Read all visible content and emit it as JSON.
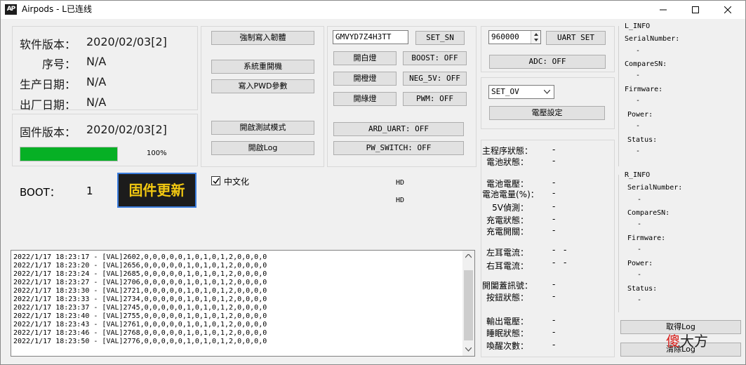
{
  "window": {
    "icon_text": "AP",
    "title": "Airpods - L已连线"
  },
  "info": {
    "software_version_label": "软件版本：",
    "software_version": "2020/02/03[2]",
    "serial_label": "序号：",
    "serial": "N/A",
    "production_date_label": "生产日期：",
    "production_date": "N/A",
    "ship_date_label": "出厂日期：",
    "ship_date": "N/A",
    "firmware_version_label": "固件版本：",
    "firmware_version": "2020/02/03[2]",
    "progress_percent": 100,
    "progress_text": "100%",
    "boot_label": "BOOT：",
    "boot_value": "1",
    "firmware_update_label": "固件更新"
  },
  "actions": {
    "force_write_firmware": "強制寫入韌體",
    "system_reboot": "系統重開機",
    "write_pwd_params": "寫入PWD參數",
    "enable_test_mode": "開啟測試模式",
    "enable_log": "開啟Log",
    "chinese_label": "中文化",
    "chinese_checked": true
  },
  "controls": {
    "sn_input": "GMVYD7Z4H3TT",
    "set_sn": "SET_SN",
    "white_light": "開白燈",
    "orange_light": "開橙燈",
    "green_light": "開綠燈",
    "boost": "BOOST: OFF",
    "neg_5v": "NEG_5V: OFF",
    "pwm": "PWM: OFF",
    "ard_uart": "ARD_UART: OFF",
    "pw_switch": "PW_SWITCH: OFF",
    "hd_1": "HD",
    "hd_2": "HD"
  },
  "uart": {
    "baud": "960000",
    "uart_set": "UART SET",
    "adc": "ADC: OFF",
    "voltage_select": "SET_OV",
    "voltage_set": "電壓設定"
  },
  "status": {
    "main_state_label": "主程序狀態：",
    "main_state": "-",
    "battery_state_label": "電池狀態：",
    "battery_state": "-",
    "battery_voltage_label": "電池電壓：",
    "battery_voltage": "-",
    "battery_level_label": "電池電量(%)：",
    "battery_level": "-",
    "v5_detect_label": "5V偵測：",
    "v5_detect": "-",
    "charge_state_label": "充電狀態：",
    "charge_state": "-",
    "charge_switch_label": "充電開關：",
    "charge_switch": "-",
    "left_current_label": "左耳電流：",
    "left_current_a": "-",
    "left_current_b": "-",
    "right_current_label": "右耳電流：",
    "right_current_a": "-",
    "right_current_b": "-",
    "lid_signal_label": "開闔蓋訊號：",
    "lid_signal": "-",
    "button_state_label": "按鈕狀態：",
    "button_state": "-",
    "output_voltage_label": "輸出電壓：",
    "output_voltage": "-",
    "sleep_state_label": "睡眠狀態：",
    "sleep_state": "-",
    "wake_count_label": "喚醒次數：",
    "wake_count": "-"
  },
  "l_info": {
    "title": "L_INFO",
    "serial_label": "SerialNumber:",
    "serial": "-",
    "compare_label": "CompareSN:",
    "compare": "-",
    "firmware_label": "Firmware:",
    "firmware": "-",
    "power_label": "Power:",
    "power": "-",
    "status_label": "Status:",
    "status": "-"
  },
  "r_info": {
    "title": "R_INFO",
    "serial_label": "SerialNumber:",
    "serial": "-",
    "compare_label": "CompareSN:",
    "compare": "-",
    "firmware_label": "Firmware:",
    "firmware": "-",
    "power_label": "Power:",
    "power": "-",
    "status_label": "Status:",
    "status": "-"
  },
  "log_buttons": {
    "get_log": "取得Log",
    "clear_log": "清除Log"
  },
  "watermark": {
    "red": "傻",
    "dark": "大方"
  },
  "log": [
    "2022/1/17 18:23:17 - [VAL]2602,0,0,0,0,0,1,0,1,0,1,2,0,0,0,0",
    "2022/1/17 18:23:20 - [VAL]2656,0,0,0,0,0,1,0,1,0,1,2,0,0,0,0",
    "2022/1/17 18:23:24 - [VAL]2685,0,0,0,0,0,1,0,1,0,1,2,0,0,0,0",
    "2022/1/17 18:23:27 - [VAL]2706,0,0,0,0,0,1,0,1,0,1,2,0,0,0,0",
    "2022/1/17 18:23:30 - [VAL]2721,0,0,0,0,0,1,0,1,0,1,2,0,0,0,0",
    "2022/1/17 18:23:33 - [VAL]2734,0,0,0,0,0,1,0,1,0,1,2,0,0,0,0",
    "2022/1/17 18:23:37 - [VAL]2745,0,0,0,0,0,1,0,1,0,1,2,0,0,0,0",
    "2022/1/17 18:23:40 - [VAL]2755,0,0,0,0,0,1,0,1,0,1,2,0,0,0,0",
    "2022/1/17 18:23:43 - [VAL]2761,0,0,0,0,0,1,0,1,0,1,2,0,0,0,0",
    "2022/1/17 18:23:46 - [VAL]2768,0,0,0,0,0,1,0,1,0,1,2,0,0,0,0",
    "2022/1/17 18:23:50 - [VAL]2776,0,0,0,0,0,1,0,1,0,1,2,0,0,0,0"
  ]
}
